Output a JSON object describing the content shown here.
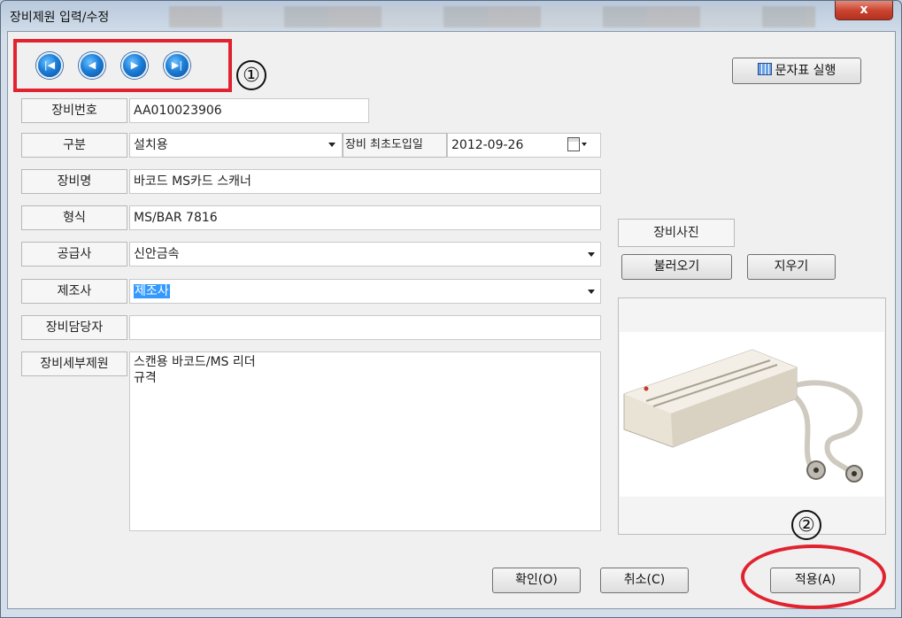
{
  "window": {
    "title": "장비제원 입력/수정",
    "close_label": "x"
  },
  "toolbar": {
    "first_icon": "first-record-icon",
    "prev_icon": "previous-record-icon",
    "next_icon": "next-record-icon",
    "last_icon": "last-record-icon",
    "charmap_label": "문자표 실행"
  },
  "annotations": {
    "one": "①",
    "two": "②"
  },
  "form": {
    "equipment_no": {
      "label": "장비번호",
      "value": "AA010023906"
    },
    "category": {
      "label": "구분",
      "value": "설치용"
    },
    "first_intro_date": {
      "label": "장비 최초도입일",
      "value": "2012-09-26"
    },
    "equipment_name": {
      "label": "장비명",
      "value": "바코드 MS카드 스캐너"
    },
    "model": {
      "label": "형식",
      "value": "MS/BAR 7816"
    },
    "supplier": {
      "label": "공급사",
      "value": "신안금속"
    },
    "manufacturer": {
      "label": "제조사",
      "value": "제조사"
    },
    "manager": {
      "label": "장비담당자",
      "value": ""
    },
    "details": {
      "label": "장비세부제원",
      "line1": "스캔용 바코드/MS 리더",
      "line2": "규격"
    }
  },
  "photo": {
    "label": "장비사진",
    "load_label": "불러오기",
    "clear_label": "지우기"
  },
  "footer": {
    "ok_label": "확인(O)",
    "cancel_label": "취소(C)",
    "apply_label": "적용(A)"
  },
  "colors": {
    "highlight": "#e1232f",
    "selection": "#3399ff"
  }
}
